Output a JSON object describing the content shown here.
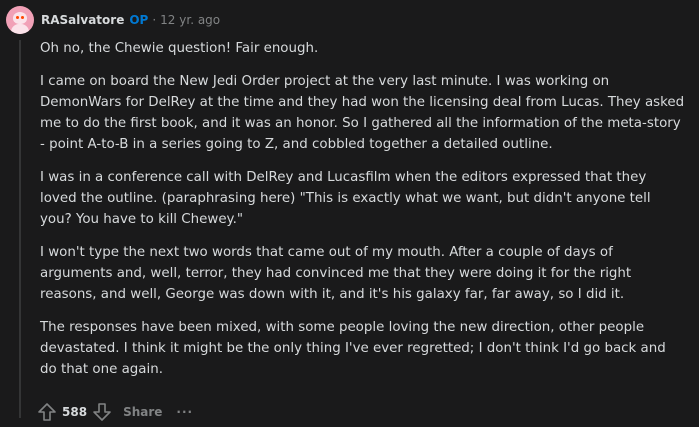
{
  "comment": {
    "author": "RASalvatore",
    "op_badge": "OP",
    "separator": "·",
    "age": "12 yr. ago",
    "paragraphs": [
      "Oh no, the Chewie question! Fair enough.",
      "I came on board the New Jedi Order project at the very last minute. I was working on DemonWars for DelRey at the time and they had won the licensing deal from Lucas. They asked me to do the first book, and it was an honor. So I gathered all the information of the meta-story - point A-to-B in a series going to Z, and cobbled together a detailed outline.",
      "I was in a conference call with DelRey and Lucasfilm when the editors expressed that they loved the outline. (paraphrasing here) \"This is exactly what we want, but didn't anyone tell you? You have to kill Chewey.\"",
      "I won't type the next two words that came out of my mouth. After a couple of days of arguments and, well, terror, they had convinced me that they were doing it for the right reasons, and well, George was down with it, and it's his galaxy far, far away, so I did it.",
      "The responses have been mixed, with some people loving the new direction, other people devastated. I think it might be the only thing I've ever regretted; I don't think I'd go back and do that one again."
    ]
  },
  "actions": {
    "score": "588",
    "share_label": "Share",
    "more_label": "···",
    "upvote_icon": "arrow-up-icon",
    "downvote_icon": "arrow-down-icon"
  },
  "colors": {
    "background": "#1a1a1b",
    "text": "#d7dadc",
    "muted": "#818384",
    "op": "#0079d3",
    "thread_line": "#343536",
    "avatar_bg": "#f1a1b7"
  }
}
